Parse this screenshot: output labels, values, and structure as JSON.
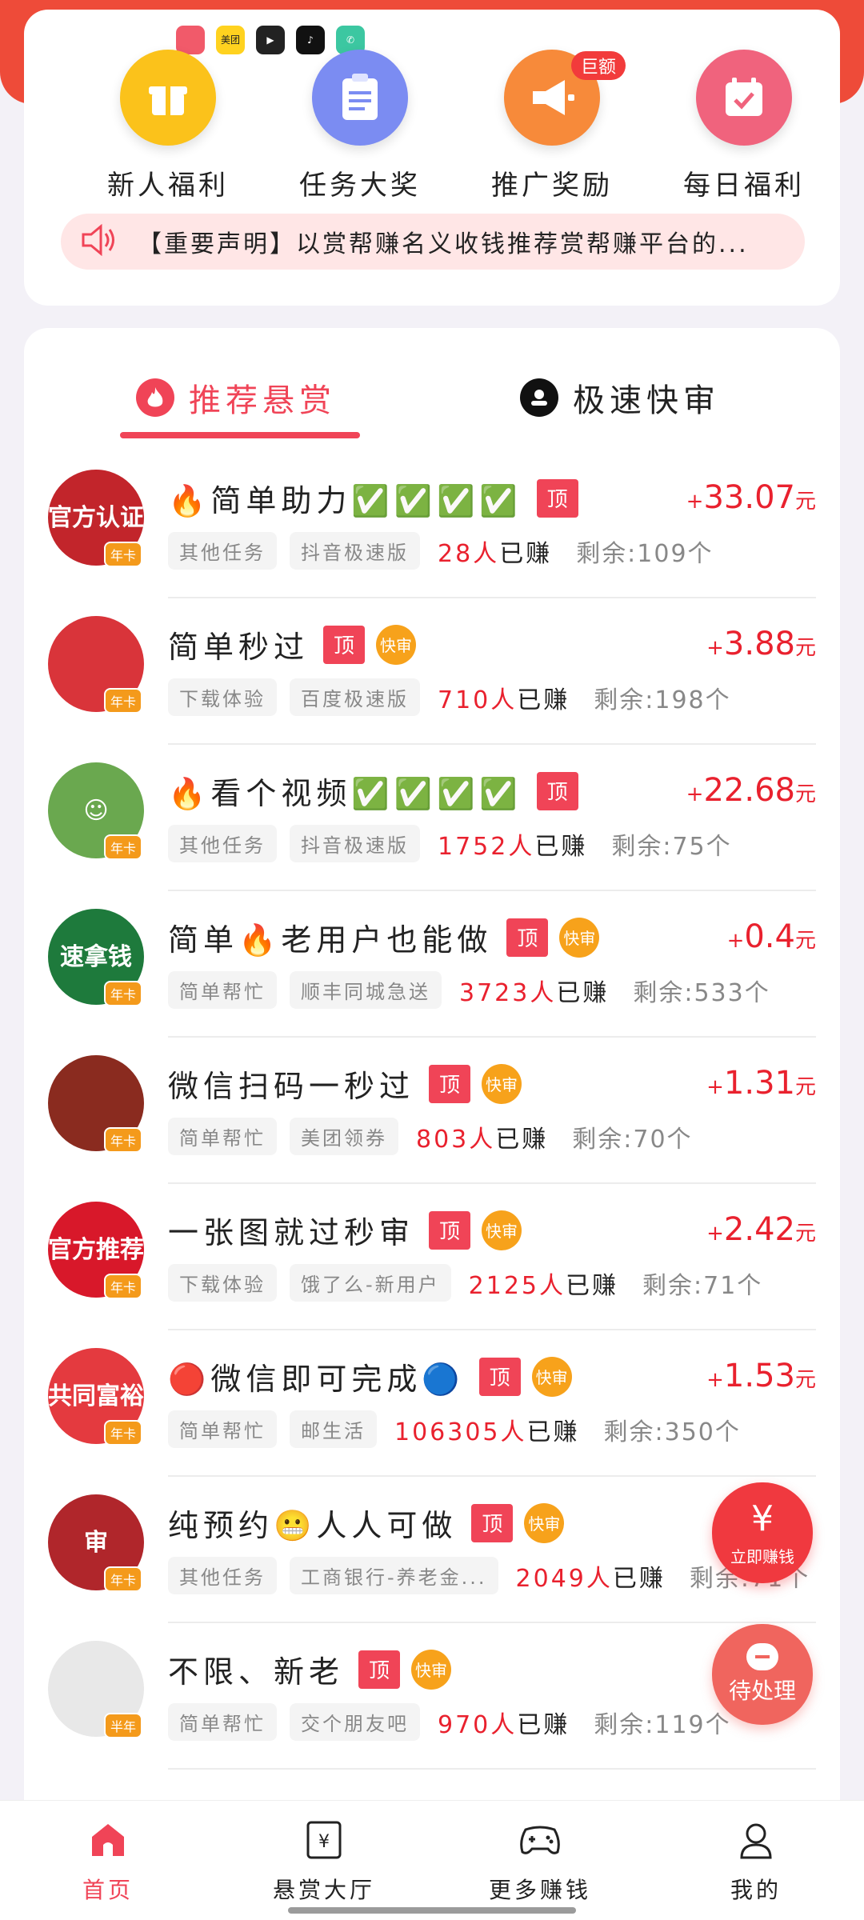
{
  "header": {
    "status_icons": [
      "app-icon-1",
      "meituan-icon",
      "video-icon",
      "tiktok-icon",
      "chat-icon"
    ],
    "features": [
      {
        "label": "新人福利",
        "icon": "gift-icon",
        "color": "#fbc21b"
      },
      {
        "label": "任务大奖",
        "icon": "clipboard-icon",
        "color": "#7b8cf2"
      },
      {
        "label": "推广奖励",
        "icon": "megaphone-icon",
        "color": "#f78a3a",
        "badge": "巨额"
      },
      {
        "label": "每日福利",
        "icon": "calendar-icon",
        "color": "#f0637d"
      }
    ],
    "notice": "【重要声明】以赏帮赚名义收钱推荐赏帮赚平台的..."
  },
  "tabs": {
    "recommended": "推荐悬赏",
    "fast_review": "极速快审"
  },
  "tasks": [
    {
      "title": "🔥简单助力✅✅✅✅",
      "top": "顶",
      "fast": "",
      "category": "其他任务",
      "source": "抖音极速版",
      "earned_num": "28人",
      "earned_suffix": "已赚",
      "remain": "剩余:109个",
      "reward": "33.07",
      "avatar_text": "官方认证",
      "avatar_color": "#c2252b",
      "year": "年卡"
    },
    {
      "title": "简单秒过",
      "top": "顶",
      "fast": "快审",
      "category": "下载体验",
      "source": "百度极速版",
      "earned_num": "710人",
      "earned_suffix": "已赚",
      "remain": "剩余:198个",
      "reward": "3.88",
      "avatar_text": "",
      "avatar_color": "#d9343a",
      "year": "年卡"
    },
    {
      "title": "🔥看个视频✅✅✅✅",
      "top": "顶",
      "fast": "",
      "category": "其他任务",
      "source": "抖音极速版",
      "earned_num": "1752人",
      "earned_suffix": "已赚",
      "remain": "剩余:75个",
      "reward": "22.68",
      "avatar_text": "☺",
      "avatar_color": "#6aa84f",
      "year": "年卡"
    },
    {
      "title": "简单🔥老用户也能做",
      "top": "顶",
      "fast": "快审",
      "category": "简单帮忙",
      "source": "顺丰同城急送",
      "earned_num": "3723人",
      "earned_suffix": "已赚",
      "remain": "剩余:533个",
      "reward": "0.4",
      "avatar_text": "速拿钱",
      "avatar_color": "#1e7a3c",
      "year": "年卡"
    },
    {
      "title": "微信扫码一秒过",
      "top": "顶",
      "fast": "快审",
      "category": "简单帮忙",
      "source": "美团领券",
      "earned_num": "803人",
      "earned_suffix": "已赚",
      "remain": "剩余:70个",
      "reward": "1.31",
      "avatar_text": "",
      "avatar_color": "#8a2b1f",
      "year": "年卡"
    },
    {
      "title": "一张图就过秒审",
      "top": "顶",
      "fast": "快审",
      "category": "下载体验",
      "source": "饿了么-新用户",
      "earned_num": "2125人",
      "earned_suffix": "已赚",
      "remain": "剩余:71个",
      "reward": "2.42",
      "avatar_text": "官方推荐",
      "avatar_color": "#d8182a",
      "year": "年卡"
    },
    {
      "title": "🔴微信即可完成🔵",
      "top": "顶",
      "fast": "快审",
      "category": "简单帮忙",
      "source": "邮生活",
      "earned_num": "106305人",
      "earned_suffix": "已赚",
      "remain": "剩余:350个",
      "reward": "1.53",
      "avatar_text": "共同富裕",
      "avatar_color": "#e43a3f",
      "year": "年卡"
    },
    {
      "title": "纯预约😬人人可做",
      "top": "顶",
      "fast": "快审",
      "category": "其他任务",
      "source": "工商银行-养老金...",
      "earned_num": "2049人",
      "earned_suffix": "已赚",
      "remain": "剩余:71个",
      "reward": "",
      "avatar_text": "审",
      "avatar_color": "#b0262b",
      "year": "年卡"
    },
    {
      "title": "不限、新老",
      "top": "顶",
      "fast": "快审",
      "category": "简单帮忙",
      "source": "交个朋友吧",
      "earned_num": "970人",
      "earned_suffix": "已赚",
      "remain": "剩余:119个",
      "reward": "",
      "avatar_text": "",
      "avatar_color": "#e8e8e8",
      "year": "半年"
    }
  ],
  "reward_prefix": "+",
  "reward_unit": "元",
  "fab": {
    "earn_label": "立即赚钱",
    "earn_symbol": "¥",
    "pending_label": "待处理"
  },
  "nav": {
    "home": "首页",
    "hall": "悬赏大厅",
    "more": "更多赚钱",
    "mine": "我的",
    "active_color": "#f04457"
  }
}
